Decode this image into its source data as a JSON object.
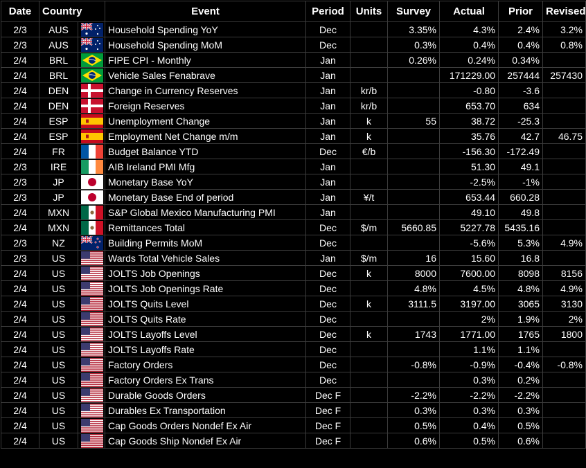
{
  "headers": {
    "date": "Date",
    "country": "Country",
    "event": "Event",
    "period": "Period",
    "units": "Units",
    "survey": "Survey",
    "actual": "Actual",
    "prior": "Prior",
    "revised": "Revised"
  },
  "rows": [
    {
      "date": "2/3",
      "country": "AUS",
      "flag": "flag-au",
      "event": "Household Spending YoY",
      "period": "Dec",
      "units": "",
      "survey": "3.35%",
      "actual": "4.3%",
      "prior": "2.4%",
      "revised": "3.2%"
    },
    {
      "date": "2/3",
      "country": "AUS",
      "flag": "flag-au",
      "event": "Household Spending MoM",
      "period": "Dec",
      "units": "",
      "survey": "0.3%",
      "actual": "0.4%",
      "prior": "0.4%",
      "revised": "0.8%"
    },
    {
      "date": "2/4",
      "country": "BRL",
      "flag": "flag-br",
      "event": "FIPE CPI - Monthly",
      "period": "Jan",
      "units": "",
      "survey": "0.26%",
      "actual": "0.24%",
      "prior": "0.34%",
      "revised": ""
    },
    {
      "date": "2/4",
      "country": "BRL",
      "flag": "flag-br",
      "event": "Vehicle Sales Fenabrave",
      "period": "Jan",
      "units": "",
      "survey": "",
      "actual": "171229.00",
      "prior": "257444",
      "revised": "257430"
    },
    {
      "date": "2/4",
      "country": "DEN",
      "flag": "flag-dk",
      "event": "Change in Currency Reserves",
      "period": "Jan",
      "units": "kr/b",
      "survey": "",
      "actual": "-0.80",
      "prior": "-3.6",
      "revised": ""
    },
    {
      "date": "2/4",
      "country": "DEN",
      "flag": "flag-dk",
      "event": "Foreign Reserves",
      "period": "Jan",
      "units": "kr/b",
      "survey": "",
      "actual": "653.70",
      "prior": "634",
      "revised": ""
    },
    {
      "date": "2/4",
      "country": "ESP",
      "flag": "flag-es",
      "event": "Unemployment Change",
      "period": "Jan",
      "units": "k",
      "survey": "55",
      "actual": "38.72",
      "prior": "-25.3",
      "revised": ""
    },
    {
      "date": "2/4",
      "country": "ESP",
      "flag": "flag-es",
      "event": "Employment Net Change m/m",
      "period": "Jan",
      "units": "k",
      "survey": "",
      "actual": "35.76",
      "prior": "42.7",
      "revised": "46.75"
    },
    {
      "date": "2/4",
      "country": "FR",
      "flag": "flag-fr",
      "event": "Budget Balance YTD",
      "period": "Dec",
      "units": "€/b",
      "survey": "",
      "actual": "-156.30",
      "prior": "-172.49",
      "revised": ""
    },
    {
      "date": "2/3",
      "country": "IRE",
      "flag": "flag-ie",
      "event": "AIB Ireland PMI Mfg",
      "period": "Jan",
      "units": "",
      "survey": "",
      "actual": "51.30",
      "prior": "49.1",
      "revised": ""
    },
    {
      "date": "2/3",
      "country": "JP",
      "flag": "flag-jp",
      "event": "Monetary Base YoY",
      "period": "Jan",
      "units": "",
      "survey": "",
      "actual": "-2.5%",
      "prior": "-1%",
      "revised": ""
    },
    {
      "date": "2/3",
      "country": "JP",
      "flag": "flag-jp",
      "event": "Monetary Base End of period",
      "period": "Jan",
      "units": "¥/t",
      "survey": "",
      "actual": "653.44",
      "prior": "660.28",
      "revised": ""
    },
    {
      "date": "2/4",
      "country": "MXN",
      "flag": "flag-mx",
      "event": "S&P Global Mexico Manufacturing PMI",
      "period": "Jan",
      "units": "",
      "survey": "",
      "actual": "49.10",
      "prior": "49.8",
      "revised": ""
    },
    {
      "date": "2/4",
      "country": "MXN",
      "flag": "flag-mx",
      "event": "Remittances Total",
      "period": "Dec",
      "units": "$/m",
      "survey": "5660.85",
      "actual": "5227.78",
      "prior": "5435.16",
      "revised": ""
    },
    {
      "date": "2/3",
      "country": "NZ",
      "flag": "flag-nz",
      "event": "Building Permits MoM",
      "period": "Dec",
      "units": "",
      "survey": "",
      "actual": "-5.6%",
      "prior": "5.3%",
      "revised": "4.9%"
    },
    {
      "date": "2/3",
      "country": "US",
      "flag": "flag-us",
      "event": "Wards Total Vehicle Sales",
      "period": "Jan",
      "units": "$/m",
      "survey": "16",
      "actual": "15.60",
      "prior": "16.8",
      "revised": ""
    },
    {
      "date": "2/4",
      "country": "US",
      "flag": "flag-us",
      "event": "JOLTS Job Openings",
      "period": "Dec",
      "units": "k",
      "survey": "8000",
      "actual": "7600.00",
      "prior": "8098",
      "revised": "8156"
    },
    {
      "date": "2/4",
      "country": "US",
      "flag": "flag-us",
      "event": "JOLTS Job Openings Rate",
      "period": "Dec",
      "units": "",
      "survey": "4.8%",
      "actual": "4.5%",
      "prior": "4.8%",
      "revised": "4.9%"
    },
    {
      "date": "2/4",
      "country": "US",
      "flag": "flag-us",
      "event": "JOLTS Quits Level",
      "period": "Dec",
      "units": "k",
      "survey": "3111.5",
      "actual": "3197.00",
      "prior": "3065",
      "revised": "3130"
    },
    {
      "date": "2/4",
      "country": "US",
      "flag": "flag-us",
      "event": "JOLTS Quits Rate",
      "period": "Dec",
      "units": "",
      "survey": "",
      "actual": "2%",
      "prior": "1.9%",
      "revised": "2%"
    },
    {
      "date": "2/4",
      "country": "US",
      "flag": "flag-us",
      "event": "JOLTS Layoffs Level",
      "period": "Dec",
      "units": "k",
      "survey": "1743",
      "actual": "1771.00",
      "prior": "1765",
      "revised": "1800"
    },
    {
      "date": "2/4",
      "country": "US",
      "flag": "flag-us",
      "event": "JOLTS Layoffs Rate",
      "period": "Dec",
      "units": "",
      "survey": "",
      "actual": "1.1%",
      "prior": "1.1%",
      "revised": ""
    },
    {
      "date": "2/4",
      "country": "US",
      "flag": "flag-us",
      "event": "Factory Orders",
      "period": "Dec",
      "units": "",
      "survey": "-0.8%",
      "actual": "-0.9%",
      "prior": "-0.4%",
      "revised": "-0.8%"
    },
    {
      "date": "2/4",
      "country": "US",
      "flag": "flag-us",
      "event": "Factory Orders Ex Trans",
      "period": "Dec",
      "units": "",
      "survey": "",
      "actual": "0.3%",
      "prior": "0.2%",
      "revised": ""
    },
    {
      "date": "2/4",
      "country": "US",
      "flag": "flag-us",
      "event": "Durable Goods Orders",
      "period": "Dec F",
      "units": "",
      "survey": "-2.2%",
      "actual": "-2.2%",
      "prior": "-2.2%",
      "revised": ""
    },
    {
      "date": "2/4",
      "country": "US",
      "flag": "flag-us",
      "event": "Durables Ex Transportation",
      "period": "Dec F",
      "units": "",
      "survey": "0.3%",
      "actual": "0.3%",
      "prior": "0.3%",
      "revised": ""
    },
    {
      "date": "2/4",
      "country": "US",
      "flag": "flag-us",
      "event": "Cap Goods Orders Nondef Ex Air",
      "period": "Dec F",
      "units": "",
      "survey": "0.5%",
      "actual": "0.4%",
      "prior": "0.5%",
      "revised": ""
    },
    {
      "date": "2/4",
      "country": "US",
      "flag": "flag-us",
      "event": "Cap Goods Ship Nondef Ex Air",
      "period": "Dec F",
      "units": "",
      "survey": "0.6%",
      "actual": "0.5%",
      "prior": "0.6%",
      "revised": ""
    }
  ]
}
